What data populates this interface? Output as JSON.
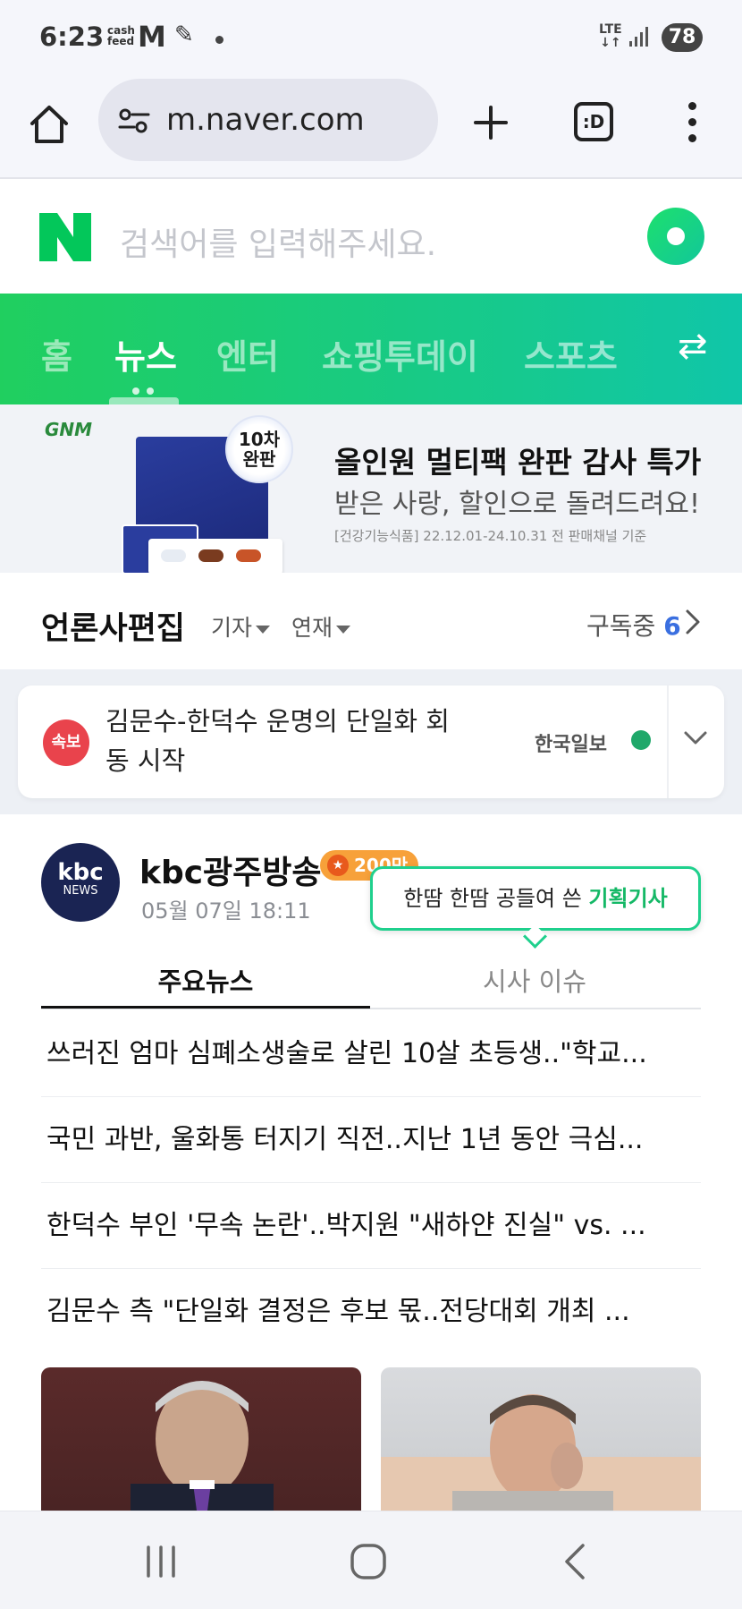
{
  "status_bar": {
    "time": "6:23",
    "cash_top": "cash",
    "cash_bottom": "feed",
    "m_letter": "M",
    "network_top": "LTE",
    "network_bottom": "↓↑",
    "battery": "78"
  },
  "browser": {
    "url": "m.naver.com",
    "tabs_label": ":D"
  },
  "search": {
    "placeholder": "검색어를 입력해주세요."
  },
  "nav": {
    "tabs": [
      {
        "label": "홈"
      },
      {
        "label": "뉴스"
      },
      {
        "label": "엔터"
      },
      {
        "label": "쇼핑투데이"
      },
      {
        "label": "스포츠"
      }
    ],
    "swap_icon": "⇄"
  },
  "ad": {
    "brand": "GNM",
    "badge_line1": "10차",
    "badge_line2": "완판",
    "headline": "올인원 멀티팩 완판 감사 특가",
    "subline": "받은 사랑, 할인으로 돌려드려요!",
    "footnote": "[건강기능식품] 22.12.01-24.10.31 전 판매채널 기준"
  },
  "press": {
    "title": "언론사편집",
    "filter1": "기자",
    "filter2": "연재",
    "subscribe_label": "구독중",
    "subscribe_count": "6"
  },
  "breaking": {
    "tag": "속보",
    "headline": "김문수-한덕수 운명의 단일화 회동 시작",
    "source": "한국일보"
  },
  "kbc": {
    "logo_top": "kbc",
    "logo_bottom": "NEWS",
    "name": "kbc광주방송",
    "subscriber_badge": "200만",
    "date": "05월 07일 18:11",
    "tooltip_prefix": "한땀 한땀 공들여 쓴 ",
    "tooltip_highlight": "기획기사",
    "tab_main": "주요뉴스",
    "tab_issue": "시사 이슈",
    "articles": [
      "쓰러진 엄마 심폐소생술로 살린 10살 초등생..\"학교...",
      "국민 과반, 울화통 터지기 직전..지난 1년 동안 극심...",
      "한덕수 부인 '무속 논란'..박지원 \"새하얀 진실\" vs. ...",
      "김문수 측 \"단일화 결정은 후보 몫..전당대회 개최 ..."
    ]
  },
  "colors": {
    "naver_green": "#03c75a",
    "breaking_red": "#e9434c",
    "subscribe_blue": "#3a6fe0",
    "highlight_green": "#14b866"
  }
}
